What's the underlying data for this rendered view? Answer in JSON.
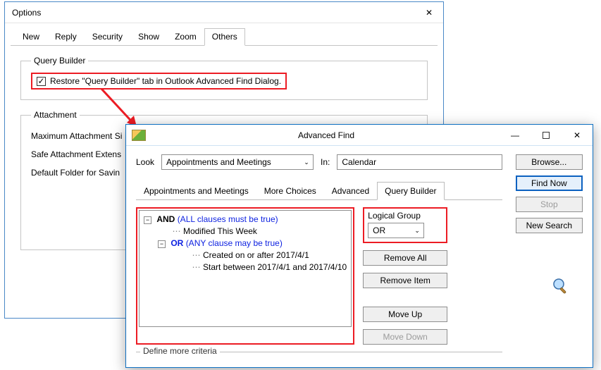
{
  "options": {
    "title": "Options",
    "tabs": [
      "New",
      "Reply",
      "Security",
      "Show",
      "Zoom",
      "Others"
    ],
    "active_tab": 5,
    "query_builder": {
      "legend": "Query Builder",
      "checkbox_label": "Restore \"Query Builder\" tab in Outlook Advanced Find Dialog.",
      "checked": true
    },
    "attachment": {
      "legend": "Attachment",
      "rows": [
        "Maximum Attachment Si",
        "Safe Attachment Extens",
        "Default Folder for Savin"
      ]
    }
  },
  "advfind": {
    "title": "Advanced Find",
    "look_label": "Look",
    "look_value": "Appointments and Meetings",
    "in_label": "In:",
    "in_value": "Calendar",
    "browse": "Browse...",
    "find_now": "Find Now",
    "stop": "Stop",
    "new_search": "New Search",
    "tabs": [
      "Appointments and Meetings",
      "More Choices",
      "Advanced",
      "Query Builder"
    ],
    "active_tab": 3,
    "tree": {
      "and": "AND",
      "and_hint": "(ALL clauses must be true)",
      "and_children": [
        "Modified This Week"
      ],
      "or": "OR",
      "or_hint": "(ANY clause may be true)",
      "or_children": [
        "Created on or after 2017/4/1",
        "Start between 2017/4/1 and 2017/4/10"
      ]
    },
    "logical_label": "Logical Group",
    "logical_value": "OR",
    "buttons": {
      "remove_all": "Remove All",
      "remove_item": "Remove Item",
      "move_up": "Move Up",
      "move_down": "Move Down"
    },
    "define_more": "Define more criteria"
  }
}
